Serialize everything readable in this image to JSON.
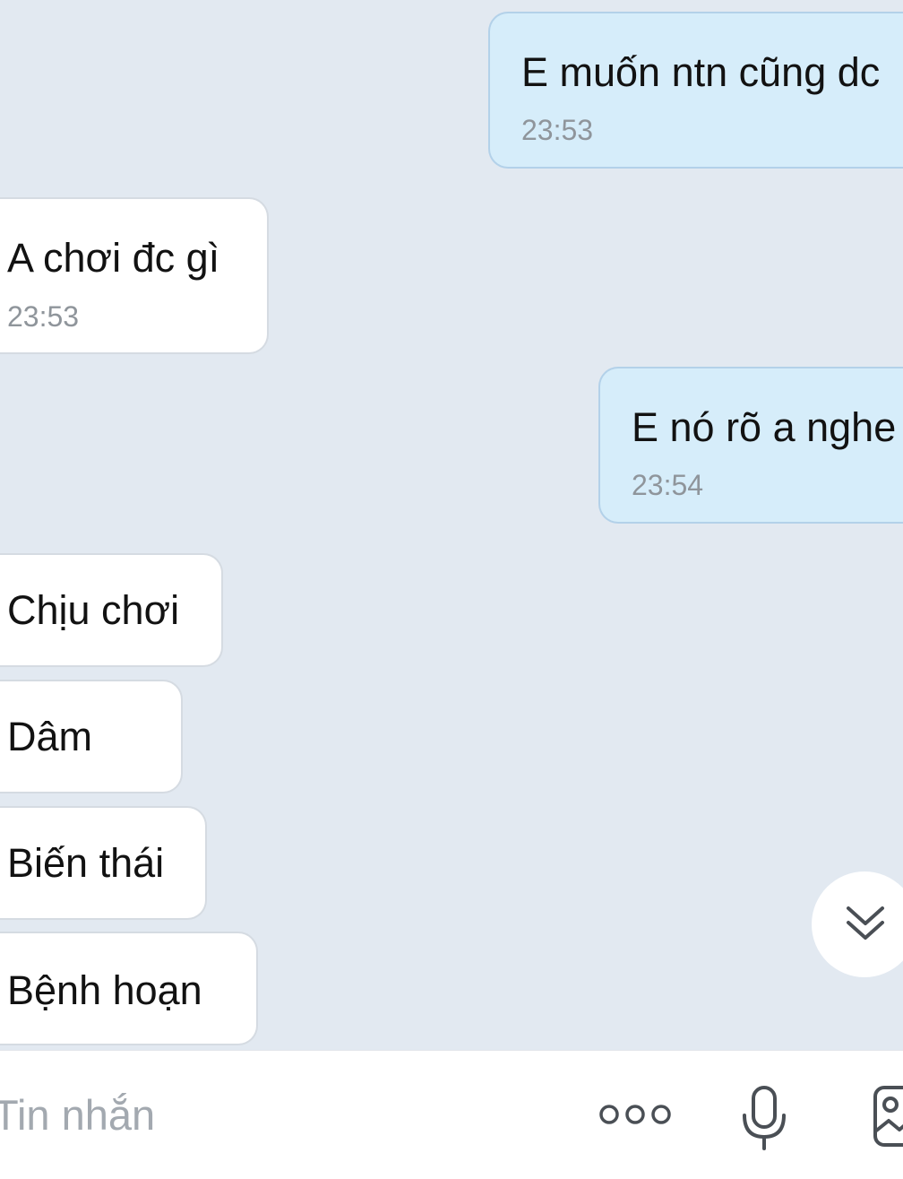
{
  "messages": [
    {
      "direction": "outgoing",
      "text": "E muốn ntn cũng dc",
      "time": "23:53"
    },
    {
      "direction": "incoming",
      "text": "A chơi đc gì",
      "time": "23:53"
    },
    {
      "direction": "outgoing",
      "text": "E nó rõ a nghe",
      "time": "23:54"
    },
    {
      "direction": "incoming",
      "text": "Chịu chơi"
    },
    {
      "direction": "incoming",
      "text": "Dâm"
    },
    {
      "direction": "incoming",
      "text": "Biến thái"
    },
    {
      "direction": "incoming",
      "text": "Bệnh hoạn"
    }
  ],
  "composer": {
    "placeholder": "Tin nhắn",
    "icons": [
      "more-options-icon",
      "microphone-icon",
      "image-icon"
    ]
  },
  "scroll_button": {
    "icon": "double-chevron-down-icon"
  },
  "colors": {
    "chat_background": "#e2e9f1",
    "outgoing_bubble": "#d6edfa",
    "incoming_bubble": "#ffffff",
    "timestamp": "#8f959b",
    "placeholder": "#a3a9b0",
    "icon": "#4a4f55"
  }
}
